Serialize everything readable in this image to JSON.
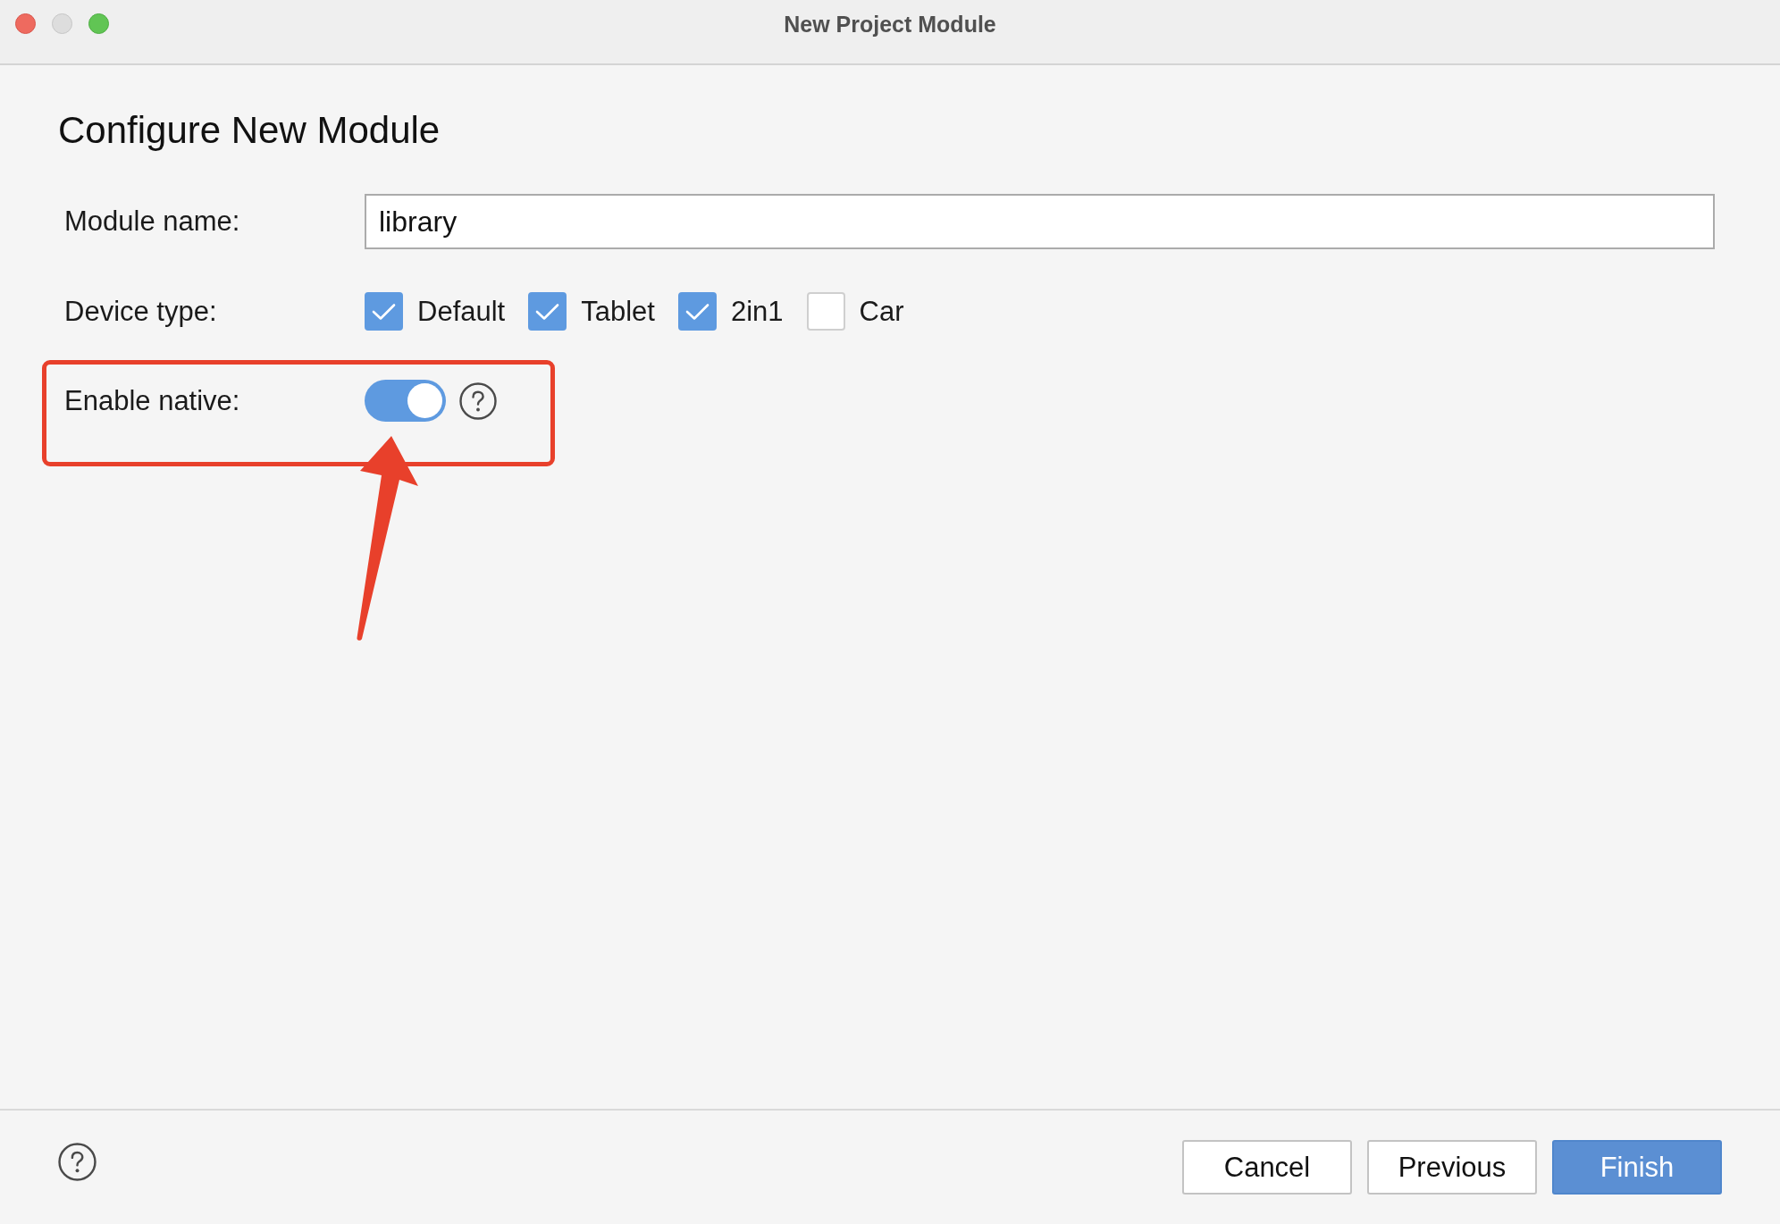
{
  "window": {
    "title": "New Project Module",
    "controls": [
      {
        "kind": "close",
        "disabled": false
      },
      {
        "kind": "minimize",
        "disabled": true
      },
      {
        "kind": "zoom",
        "disabled": false
      }
    ]
  },
  "heading": "Configure New Module",
  "form": {
    "module_name": {
      "label": "Module name:",
      "value": "library"
    },
    "device_type": {
      "label": "Device type:",
      "options": [
        {
          "label": "Default",
          "checked": true
        },
        {
          "label": "Tablet",
          "checked": true
        },
        {
          "label": "2in1",
          "checked": true
        },
        {
          "label": "Car",
          "checked": false
        }
      ]
    },
    "enable_native": {
      "label": "Enable native:",
      "on": true
    }
  },
  "buttons": [
    {
      "label": "Cancel",
      "primary": false
    },
    {
      "label": "Previous",
      "primary": false
    },
    {
      "label": "Finish",
      "primary": true
    }
  ]
}
